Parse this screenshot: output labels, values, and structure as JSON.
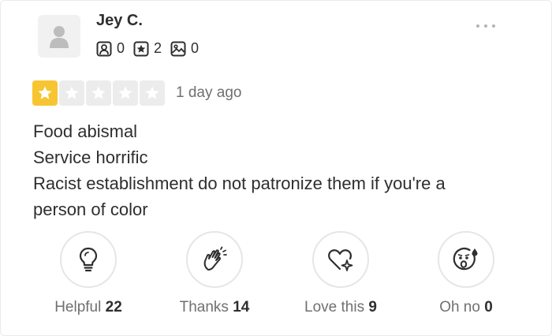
{
  "user": {
    "name": "Jey C.",
    "stats": [
      {
        "icon": "friends-icon",
        "value": "0"
      },
      {
        "icon": "review-star-icon",
        "value": "2"
      },
      {
        "icon": "photo-icon",
        "value": "0"
      }
    ]
  },
  "rating": {
    "value": 1,
    "max": 5,
    "date": "1 day ago"
  },
  "review": {
    "lines": [
      "Food abismal",
      "Service horrific",
      "Racist establishment do not patronize them if you're a",
      "person of color"
    ]
  },
  "reactions": [
    {
      "icon": "lightbulb-icon",
      "label": "Helpful",
      "count": "22"
    },
    {
      "icon": "clapping-hands-icon",
      "label": "Thanks",
      "count": "14"
    },
    {
      "icon": "heart-sparkle-icon",
      "label": "Love this",
      "count": "9"
    },
    {
      "icon": "shocked-face-icon",
      "label": "Oh no",
      "count": "0"
    }
  ],
  "colors": {
    "star_on": "#f7c531",
    "star_off": "#ececec",
    "text": "#2d2e2f",
    "muted": "#6e7072"
  }
}
